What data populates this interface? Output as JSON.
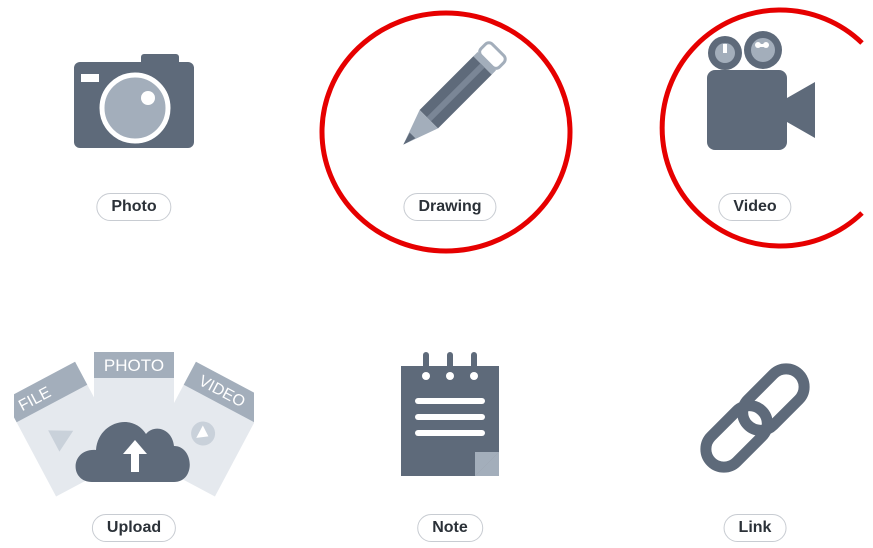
{
  "colors": {
    "icon_dark": "#5e6a7a",
    "icon_light": "#a3aebb",
    "label_border": "#c8ccd2",
    "label_text": "#2b3138",
    "highlight_circle": "#e60000"
  },
  "tiles": [
    {
      "label": "Photo",
      "icon": "camera-icon"
    },
    {
      "label": "Drawing",
      "icon": "pencil-icon",
      "highlighted": true
    },
    {
      "label": "Video",
      "icon": "video-camera-icon",
      "highlighted": true
    },
    {
      "label": "Upload",
      "icon": "cloud-upload-icon"
    },
    {
      "label": "Note",
      "icon": "notepad-icon"
    },
    {
      "label": "Link",
      "icon": "chain-link-icon"
    }
  ],
  "upload_cards": {
    "left": "FILE",
    "center": "PHOTO",
    "right": "VIDEO"
  }
}
